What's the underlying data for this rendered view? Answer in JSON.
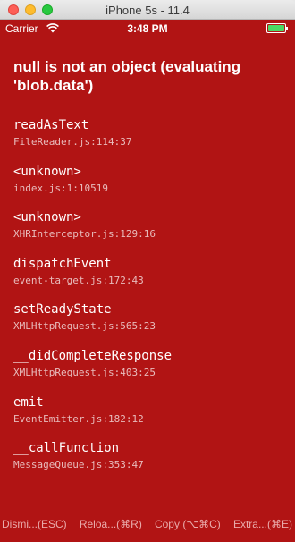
{
  "window": {
    "title": "iPhone 5s - 11.4"
  },
  "statusbar": {
    "carrier": "Carrier",
    "time": "3:48 PM",
    "wifi_icon": "wifi-icon",
    "battery_icon": "battery-icon",
    "battery_color": "#4cd964"
  },
  "error": {
    "message": "null is not an object (evaluating 'blob.data')",
    "background_color": "#b11414"
  },
  "stack": [
    {
      "method": "readAsText",
      "location": "FileReader.js:114:37"
    },
    {
      "method": "<unknown>",
      "location": "index.js:1:10519"
    },
    {
      "method": "<unknown>",
      "location": "XHRInterceptor.js:129:16"
    },
    {
      "method": "dispatchEvent",
      "location": "event-target.js:172:43"
    },
    {
      "method": "setReadyState",
      "location": "XMLHttpRequest.js:565:23"
    },
    {
      "method": "__didCompleteResponse",
      "location": "XMLHttpRequest.js:403:25"
    },
    {
      "method": "emit",
      "location": "EventEmitter.js:182:12"
    },
    {
      "method": "__callFunction",
      "location": "MessageQueue.js:353:47"
    }
  ],
  "toolbar": {
    "dismiss": "Dismi...(ESC)",
    "reload": "Reloa...(⌘R)",
    "copy": "Copy (⌥⌘C)",
    "extra": "Extra...(⌘E)"
  }
}
